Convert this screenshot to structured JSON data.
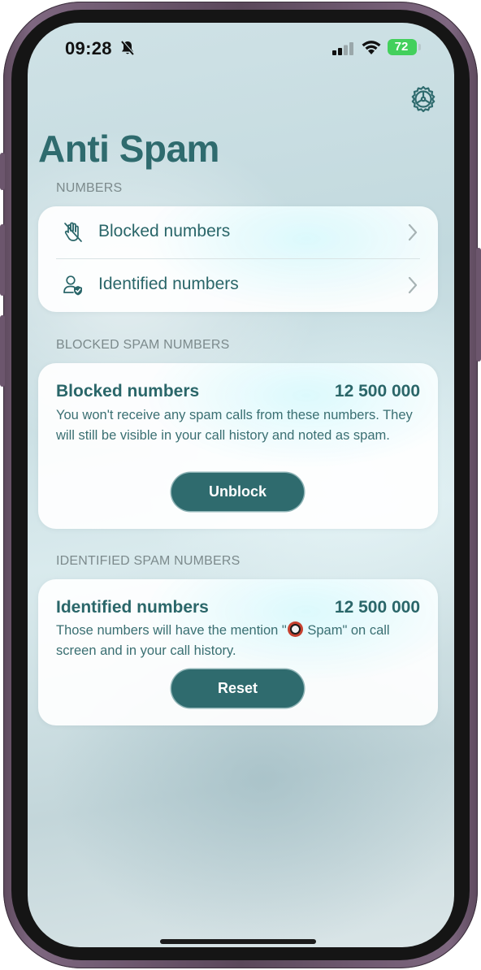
{
  "status_bar": {
    "time": "09:28",
    "battery": "72"
  },
  "header": {
    "title": "Anti Spam",
    "settings_icon": "gear-icon"
  },
  "numbers_section": {
    "label": "NUMBERS",
    "items": [
      {
        "label": "Blocked numbers",
        "icon": "hand-blocked-icon"
      },
      {
        "label": "Identified numbers",
        "icon": "person-check-icon"
      }
    ]
  },
  "blocked_section": {
    "label": "BLOCKED SPAM NUMBERS",
    "title": "Blocked numbers",
    "count": "12 500 000",
    "description": "You won't receive any spam calls from these numbers. They will still be visible in your call history and noted as spam.",
    "button_label": "Unblock"
  },
  "identified_section": {
    "label": "IDENTIFIED SPAM NUMBERS",
    "title": "Identified numbers",
    "count": "12 500 000",
    "description_before": "Those numbers will have the mention \"",
    "description_spam": " Spam",
    "description_after": "\" on call screen and in your call history.",
    "button_label": "Reset"
  },
  "colors": {
    "accent": "#2f6b6e",
    "section_label": "#7c8a8c",
    "battery": "#43d05c"
  }
}
